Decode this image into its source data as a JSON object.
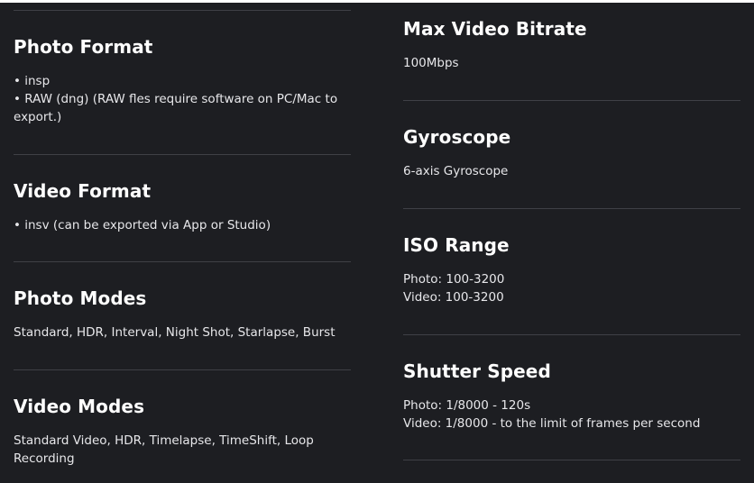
{
  "left_column": [
    {
      "title": "Photo Format",
      "lines": [
        "• insp",
        "• RAW (dng) (RAW fles require software on PC/Mac to export.)"
      ]
    },
    {
      "title": "Video Format",
      "lines": [
        "• insv (can be exported via App or Studio)"
      ]
    },
    {
      "title": "Photo Modes",
      "lines": [
        "Standard, HDR, Interval, Night Shot, Starlapse, Burst"
      ]
    },
    {
      "title": "Video Modes",
      "lines": [
        "Standard Video, HDR, Timelapse, TimeShift, Loop Recording"
      ]
    }
  ],
  "right_column": [
    {
      "title": "Max Video Bitrate",
      "lines": [
        "100Mbps"
      ]
    },
    {
      "title": "Gyroscope",
      "lines": [
        "6-axis Gyroscope"
      ]
    },
    {
      "title": "ISO Range",
      "lines": [
        "Photo: 100-3200",
        "Video: 100-3200"
      ]
    },
    {
      "title": "Shutter Speed",
      "lines": [
        "Photo: 1/8000 - 120s",
        "Video: 1/8000 - to the limit of frames per second"
      ]
    }
  ],
  "colors": {
    "background": "#1d1e22",
    "text": "#ffffff",
    "divider": "#3f4046"
  }
}
